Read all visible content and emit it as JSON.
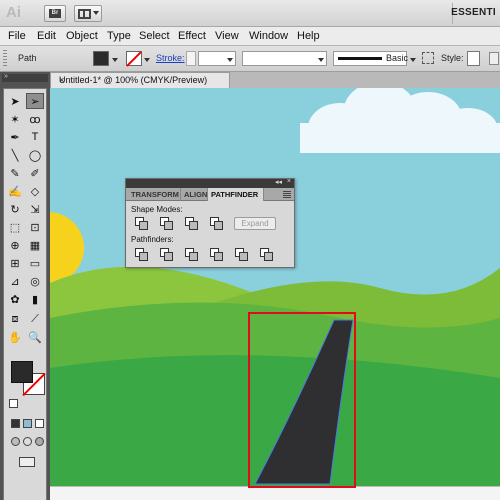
{
  "app": {
    "logo": "Ai",
    "workspace": "ESSENTI"
  },
  "menu": [
    "File",
    "Edit",
    "Object",
    "Type",
    "Select",
    "Effect",
    "View",
    "Window",
    "Help"
  ],
  "control_bar": {
    "selection_label": "Path",
    "stroke_label": "Stroke:",
    "brush_label": "Basic",
    "style_label": "Style:",
    "fill_color": "#2b2b2b",
    "stroke_color": "none"
  },
  "document": {
    "tab_title": "Untitled-1* @ 100% (CMYK/Preview)",
    "close_glyph": "×"
  },
  "pathfinder": {
    "tabs": [
      "TRANSFORM",
      "ALIGN",
      "PATHFINDER"
    ],
    "active_tab": "PATHFINDER",
    "shape_modes_label": "Shape Modes:",
    "pathfinders_label": "Pathfinders:",
    "expand_label": "Expand",
    "collapse_glyph": "◂◂",
    "close_glyph": "×"
  },
  "colors": {
    "sky": "#8ad0dc",
    "hill_light": "#8cc63f",
    "hill_dark": "#39a845",
    "sun": "#f7d21c",
    "road": "#2f2f31",
    "highlight": "#e10c1b"
  }
}
